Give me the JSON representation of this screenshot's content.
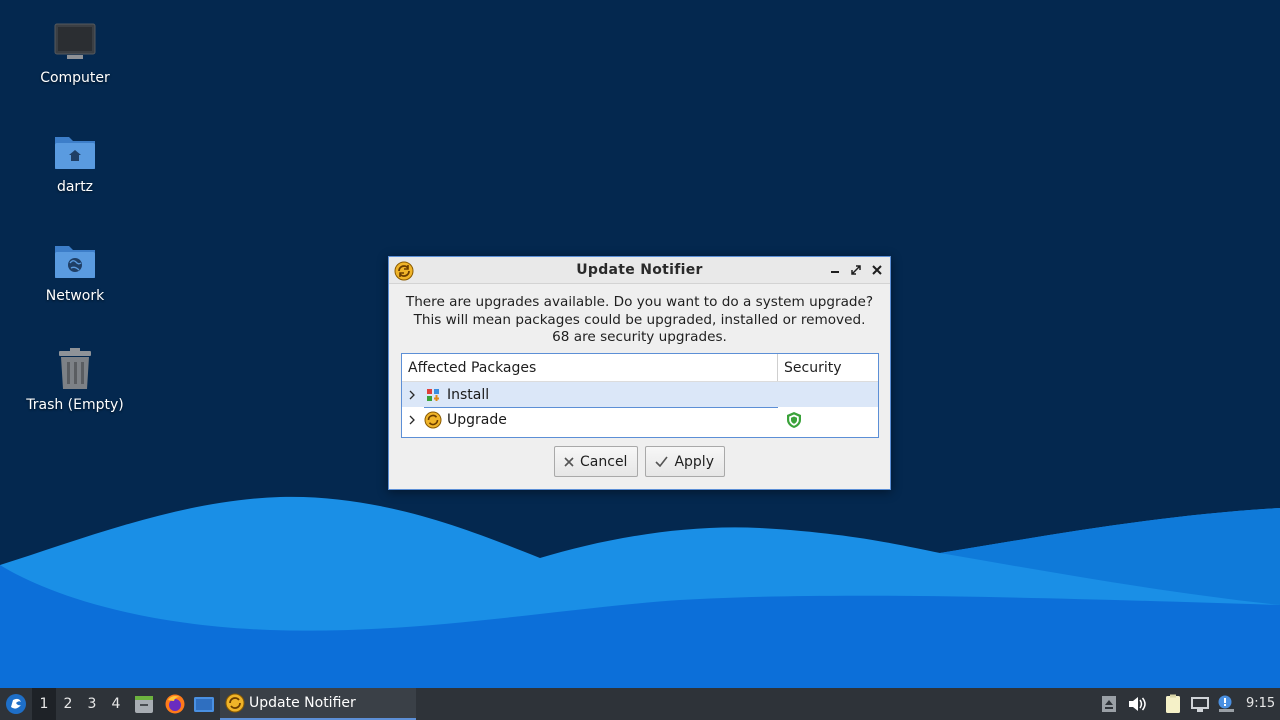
{
  "desktop": {
    "icons": [
      {
        "label": "Computer",
        "icon": "computer-icon"
      },
      {
        "label": "dartz",
        "icon": "home-folder-icon"
      },
      {
        "label": "Network",
        "icon": "network-folder-icon"
      },
      {
        "label": "Trash (Empty)",
        "icon": "trash-icon"
      }
    ]
  },
  "dialog": {
    "title": "Update Notifier",
    "message_lines": [
      "There are upgrades available. Do you want to do a system upgrade?",
      "This will mean packages could be upgraded, installed or removed.",
      "68 are security upgrades."
    ],
    "columns": [
      "Affected Packages",
      "Security"
    ],
    "rows": [
      {
        "label": "Install",
        "icon": "install-icon",
        "security": false,
        "selected": true
      },
      {
        "label": "Upgrade",
        "icon": "upgrade-icon",
        "security": true,
        "selected": false
      }
    ],
    "buttons": {
      "cancel": "Cancel",
      "apply": "Apply"
    }
  },
  "taskbar": {
    "workspaces": [
      "1",
      "2",
      "3",
      "4"
    ],
    "active_workspace": "1",
    "task_label": "Update Notifier",
    "clock": "9:15"
  },
  "colors": {
    "desktop_bg": "#04284f",
    "accent": "#5c8fd6",
    "taskbar_bg": "#2e3339",
    "selection": "#dbe7f8",
    "security_green": "#3aa23a"
  }
}
